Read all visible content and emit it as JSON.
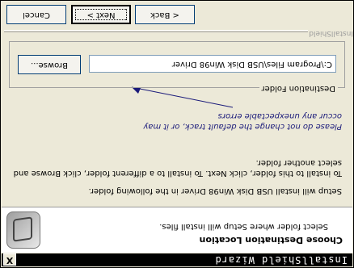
{
  "window": {
    "title": "InstallShield Wizard",
    "close_label": "X"
  },
  "header": {
    "title": "Choose Destination Location",
    "subtitle": "Select folder where Setup will install files.",
    "logo_icon": "installshield-logo-icon"
  },
  "body": {
    "line1": "Setup will install USB Disk Win98 Driver in the following folder.",
    "line2": "To install to this folder, click Next. To install to a different folder, click Browse and select another folder."
  },
  "annotation": {
    "text": "Please do not change the default track, or it may occur any unexpectable errors",
    "color": "#1a1a7a"
  },
  "destination": {
    "group_label": "Destination Folder",
    "path": "C:\\Program Files\\USB Disk Win98 Driver",
    "browse_label": "Browse..."
  },
  "footer": {
    "brand": "InstallShield",
    "back_label": "< Back",
    "next_label": "Next >",
    "cancel_label": "Cancel"
  }
}
